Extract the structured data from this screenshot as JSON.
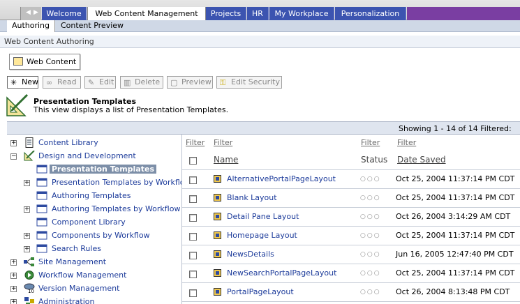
{
  "top_tabs": [
    "Welcome",
    "Web Content Management",
    "Projects",
    "HR",
    "My Workplace",
    "Personalization"
  ],
  "sub_tabs": [
    "Authoring",
    "Content Preview"
  ],
  "section_title": "Web Content Authoring",
  "web_content_button": "Web Content",
  "toolbar": {
    "new": "New",
    "read": "Read",
    "edit": "Edit",
    "delete": "Delete",
    "preview": "Preview",
    "edit_security": "Edit Security"
  },
  "view": {
    "title": "Presentation Templates",
    "description": "This view displays a list of Presentation Templates."
  },
  "showing": "Showing 1 - 14 of 14   Filtered:",
  "tree": [
    "Content Library",
    "Design and Development",
    "Presentation Templates",
    "Presentation Templates by Workflow",
    "Authoring Templates",
    "Authoring Templates by Workflow",
    "Component Library",
    "Components by Workflow",
    "Search Rules",
    "Site Management",
    "Workflow Management",
    "Version Management",
    "Administration"
  ],
  "table": {
    "filter_label": "Filter",
    "columns": {
      "name": "Name",
      "status": "Status",
      "date_saved": "Date Saved"
    },
    "status_dots": "○○○",
    "rows": [
      {
        "name": "AlternativePortalPageLayout",
        "date": "Oct 25, 2004 11:37:14 PM CDT"
      },
      {
        "name": "Blank Layout",
        "date": "Oct 25, 2004 11:37:14 PM CDT"
      },
      {
        "name": "Detail Pane Layout",
        "date": "Oct 26, 2004 3:14:29 AM CDT"
      },
      {
        "name": "Homepage Layout",
        "date": "Oct 25, 2004 11:37:14 PM CDT"
      },
      {
        "name": "NewsDetails",
        "date": "Jun 16, 2005 12:47:40 PM CDT"
      },
      {
        "name": "NewSearchPortalPageLayout",
        "date": "Oct 25, 2004 11:37:14 PM CDT"
      },
      {
        "name": "PortalPageLayout",
        "date": "Oct 26, 2004 8:13:48 PM CDT"
      }
    ]
  }
}
